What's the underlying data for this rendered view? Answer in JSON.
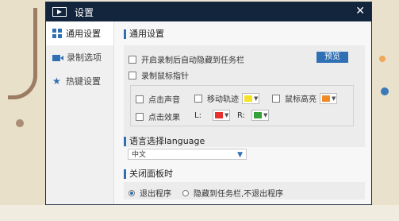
{
  "window": {
    "title": "设置",
    "close_label": "✕"
  },
  "sidebar": {
    "items": [
      {
        "label": "通用设置",
        "icon": "grid-icon",
        "active": true
      },
      {
        "label": "录制选项",
        "icon": "camera-icon",
        "active": false
      },
      {
        "label": "热键设置",
        "icon": "star-icon",
        "active": false
      }
    ]
  },
  "general": {
    "section_title": "通用设置",
    "auto_hide_label": "开启录制后自动隐藏到任务栏",
    "preview_label": "预览",
    "record_cursor_label": "录制鼠标指针",
    "click_sound_label": "点击声音",
    "move_trail_label": "移动轨迹",
    "move_trail_color": "#f5e12a",
    "mouse_highlight_label": "鼠标高亮",
    "mouse_highlight_color": "#f08a24",
    "click_effect_label": "点击效果",
    "l_label": "L:",
    "l_color": "#e8312e",
    "r_label": "R:",
    "r_color": "#36a03a"
  },
  "language": {
    "section_title": "语言选择language",
    "selected": "中文"
  },
  "close_panel": {
    "section_title": "关闭面板时",
    "option_exit": "退出程序",
    "option_hide": "隐藏到任务栏,不退出程序",
    "selected": "exit"
  },
  "colors": {
    "accent": "#2f6fb3",
    "titlebar": "#13243d"
  }
}
